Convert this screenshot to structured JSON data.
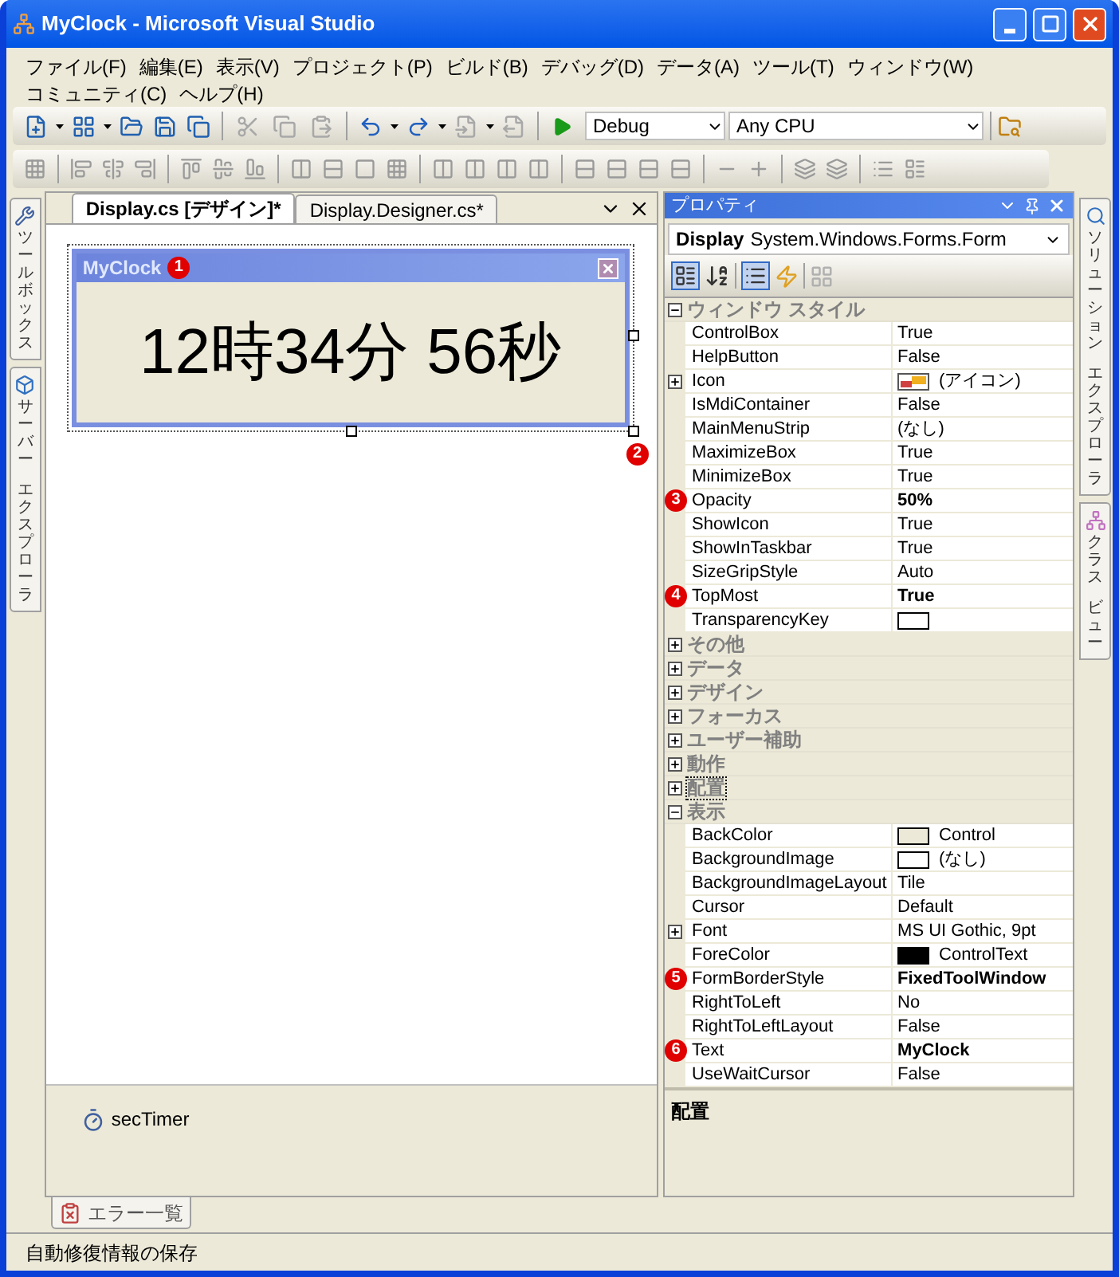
{
  "window": {
    "title": "MyClock - Microsoft Visual Studio"
  },
  "menu": [
    {
      "label": "ファイル(F)"
    },
    {
      "label": "編集(E)"
    },
    {
      "label": "表示(V)"
    },
    {
      "label": "プロジェクト(P)"
    },
    {
      "label": "ビルド(B)"
    },
    {
      "label": "デバッグ(D)"
    },
    {
      "label": "データ(A)"
    },
    {
      "label": "ツール(T)"
    },
    {
      "label": "ウィンドウ(W)"
    },
    {
      "label": "コミュニティ(C)"
    },
    {
      "label": "ヘルプ(H)"
    }
  ],
  "toolbar": {
    "configuration": "Debug",
    "platform": "Any CPU"
  },
  "left_tabs": [
    {
      "label_parts": [
        "ツールボックス"
      ]
    },
    {
      "label_parts": [
        "サーバー",
        "エクスプローラ"
      ]
    }
  ],
  "right_tabs": [
    {
      "label_parts": [
        "ソリューション",
        "エクスプローラ"
      ]
    },
    {
      "label_parts": [
        "クラス",
        "ビュー"
      ]
    }
  ],
  "document_tabs": [
    {
      "label": "Display.cs [デザイン]*",
      "selected": true
    },
    {
      "label": "Display.Designer.cs*",
      "selected": false
    }
  ],
  "designer": {
    "form_title": "MyClock",
    "form_badge": "1",
    "clock_text": "12時34分 56秒",
    "resize_badge": "2",
    "tray": [
      {
        "label": "secTimer"
      }
    ]
  },
  "properties": {
    "title": "プロパティ",
    "object_name": "Display",
    "object_type": "System.Windows.Forms.Form",
    "rows": [
      {
        "kind": "category",
        "name": "ウィンドウ スタイル",
        "expanded": true
      },
      {
        "kind": "property",
        "name": "ControlBox",
        "value": "True",
        "modified": false
      },
      {
        "kind": "property",
        "name": "HelpButton",
        "value": "False",
        "modified": false
      },
      {
        "kind": "property",
        "name": "Icon",
        "value": "(アイコン)",
        "modified": false,
        "expandable": true,
        "image_swatch": true
      },
      {
        "kind": "property",
        "name": "IsMdiContainer",
        "value": "False",
        "modified": false
      },
      {
        "kind": "property",
        "name": "MainMenuStrip",
        "value": "(なし)",
        "modified": false
      },
      {
        "kind": "property",
        "name": "MaximizeBox",
        "value": "True",
        "modified": false
      },
      {
        "kind": "property",
        "name": "MinimizeBox",
        "value": "True",
        "modified": false
      },
      {
        "kind": "property",
        "name": "Opacity",
        "value": "50%",
        "modified": true,
        "badge": "3"
      },
      {
        "kind": "property",
        "name": "ShowIcon",
        "value": "True",
        "modified": false
      },
      {
        "kind": "property",
        "name": "ShowInTaskbar",
        "value": "True",
        "modified": false
      },
      {
        "kind": "property",
        "name": "SizeGripStyle",
        "value": "Auto",
        "modified": false
      },
      {
        "kind": "property",
        "name": "TopMost",
        "value": "True",
        "modified": true,
        "badge": "4"
      },
      {
        "kind": "property",
        "name": "TransparencyKey",
        "color": "#ffffff"
      },
      {
        "kind": "category",
        "name": "その他",
        "expanded": false
      },
      {
        "kind": "category",
        "name": "データ",
        "expanded": false
      },
      {
        "kind": "category",
        "name": "デザイン",
        "expanded": false
      },
      {
        "kind": "category",
        "name": "フォーカス",
        "expanded": false
      },
      {
        "kind": "category",
        "name": "ユーザー補助",
        "expanded": false
      },
      {
        "kind": "category",
        "name": "動作",
        "expanded": false
      },
      {
        "kind": "category",
        "name": "配置",
        "expanded": false,
        "selected": true
      },
      {
        "kind": "category",
        "name": "表示",
        "expanded": true
      },
      {
        "kind": "property",
        "name": "BackColor",
        "value": "Control",
        "modified": false,
        "color": "#ece9d8"
      },
      {
        "kind": "property",
        "name": "BackgroundImage",
        "value": "(なし)",
        "modified": false,
        "color": "#ffffff"
      },
      {
        "kind": "property",
        "name": "BackgroundImageLayout",
        "value": "Tile",
        "modified": false
      },
      {
        "kind": "property",
        "name": "Cursor",
        "value": "Default",
        "modified": false
      },
      {
        "kind": "property",
        "name": "Font",
        "value": "MS UI Gothic, 9pt",
        "modified": false,
        "expandable": true
      },
      {
        "kind": "property",
        "name": "ForeColor",
        "value": "ControlText",
        "modified": false,
        "color": "#000000"
      },
      {
        "kind": "property",
        "name": "FormBorderStyle",
        "value": "FixedToolWindow",
        "modified": true,
        "badge": "5"
      },
      {
        "kind": "property",
        "name": "RightToLeft",
        "value": "No",
        "modified": false
      },
      {
        "kind": "property",
        "name": "RightToLeftLayout",
        "value": "False",
        "modified": false
      },
      {
        "kind": "property",
        "name": "Text",
        "value": "MyClock",
        "modified": true,
        "badge": "6"
      },
      {
        "kind": "property",
        "name": "UseWaitCursor",
        "value": "False",
        "modified": false
      }
    ],
    "description": "配置"
  },
  "bottom_tabs": [
    {
      "label": "エラー一覧"
    }
  ],
  "status_bar": "自動修復情報の保存"
}
